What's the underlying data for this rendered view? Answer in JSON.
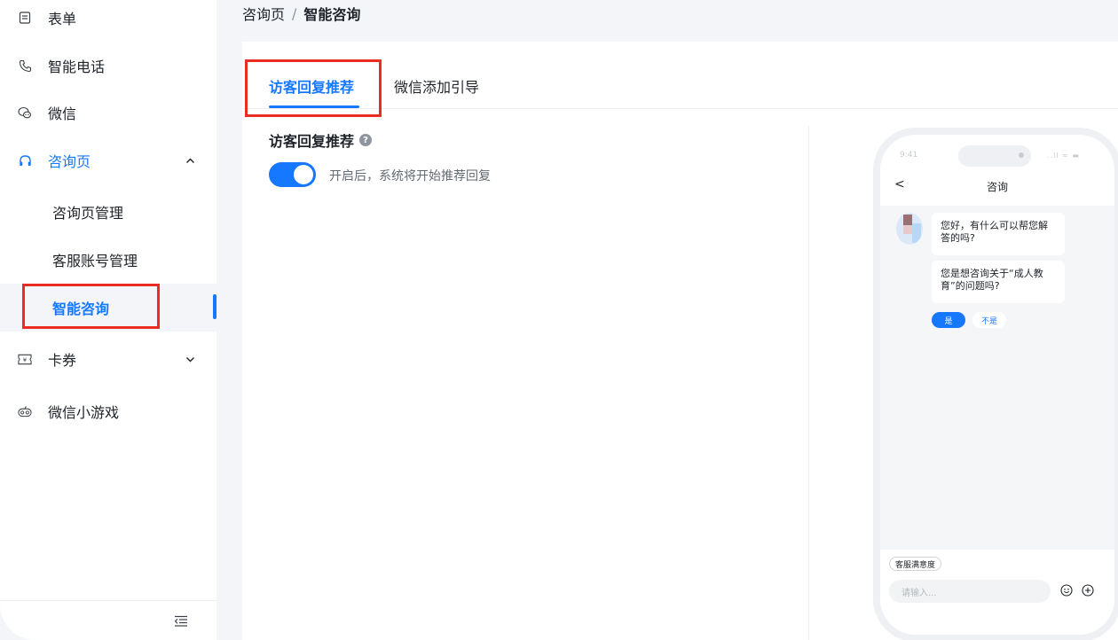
{
  "sidebar": {
    "items": [
      {
        "label": "表单",
        "icon": "form-icon"
      },
      {
        "label": "智能电话",
        "icon": "phone-icon"
      },
      {
        "label": "微信",
        "icon": "wechat-icon"
      },
      {
        "label": "咨询页",
        "icon": "headset-icon",
        "expanded": true
      },
      {
        "label": "卡券",
        "icon": "coupon-icon",
        "expanded": false
      },
      {
        "label": "微信小游戏",
        "icon": "gamepad-icon"
      }
    ],
    "sub_items": [
      {
        "label": "咨询页管理"
      },
      {
        "label": "客服账号管理"
      },
      {
        "label": "智能咨询",
        "selected": true
      }
    ]
  },
  "breadcrumb": {
    "parent": "咨询页",
    "separator": "/",
    "current": "智能咨询"
  },
  "tabs": [
    {
      "label": "访客回复推荐",
      "active": true
    },
    {
      "label": "微信添加引导",
      "active": false
    }
  ],
  "section": {
    "title": "访客回复推荐",
    "help": "?",
    "toggle_on": true,
    "toggle_desc": "开启后，系统将开始推荐回复"
  },
  "phone": {
    "time": "9:41",
    "status_icons": "..ll ≈ ▬",
    "back": "<",
    "title": "咨询",
    "messages": [
      "您好，有什么可以帮您解答的吗?",
      "您是想咨询关于“成人教育”的问题吗?"
    ],
    "quick_replies": {
      "yes": "是",
      "no": "不是"
    },
    "satisfaction": "客服满意度",
    "input_placeholder": "请输入..."
  },
  "colors": {
    "accent": "#1677ff",
    "highlight_box": "#ea2c22",
    "background": "#f3f5f8"
  }
}
